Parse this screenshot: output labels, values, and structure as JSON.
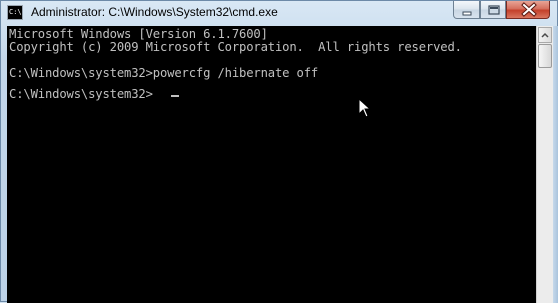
{
  "window": {
    "title": "Administrator: C:\\Windows\\System32\\cmd.exe",
    "icon": "cmd-icon",
    "icon_text": "C:\\"
  },
  "controls": {
    "minimize": "minimize-icon",
    "maximize": "maximize-icon",
    "close": "close-icon"
  },
  "console": {
    "lines": [
      "Microsoft Windows [Version 6.1.7600]",
      "Copyright (c) 2009 Microsoft Corporation.  All rights reserved.",
      "",
      "C:\\Windows\\system32>powercfg /hibernate off",
      "",
      "C:\\Windows\\system32>"
    ],
    "colors": {
      "background": "#000000",
      "foreground": "#c0c0c0"
    }
  },
  "colors": {
    "frame": "#bcd2e7",
    "close_button": "#c4402a"
  }
}
